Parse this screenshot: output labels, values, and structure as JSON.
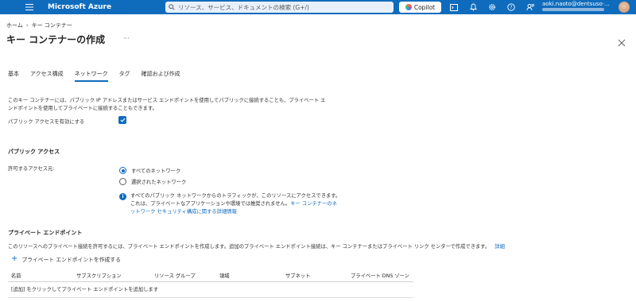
{
  "header": {
    "brand": "Microsoft Azure",
    "search_placeholder": "リソース、サービス、ドキュメントの検索 (G+/)",
    "copilot_label": "Copilot",
    "account_name": "aoki.naoto@dentsuso·..."
  },
  "breadcrumb": {
    "home": "ホーム",
    "current": "キー コンテナー"
  },
  "page": {
    "title": "キー コンテナーの作成",
    "more": "···"
  },
  "tabs": [
    {
      "label": "基本"
    },
    {
      "label": "アクセス構成"
    },
    {
      "label": "ネットワーク"
    },
    {
      "label": "タグ"
    },
    {
      "label": "確認および作成"
    }
  ],
  "network": {
    "description": "このキー コンテナーには、パブリック IP アドレスまたはサービス エンドポイントを使用してパブリックに接続することも、プライベート エンドポイントを使用してプライベートに接続することもできます。",
    "public_access_label": "パブリック アクセスを有効にする",
    "public_access_enabled": true,
    "public_access_heading": "パブリック アクセス",
    "allow_access_label": "許可するアクセス元:",
    "options": [
      {
        "label": "すべてのネットワーク",
        "selected": true
      },
      {
        "label": "選択されたネットワーク",
        "selected": false
      }
    ],
    "info_text": "すべてのパブリック ネットワークからのトラフィックが、このリソースにアクセスできます。これは、プライベートなアプリケーションや環境では推奨されません。",
    "info_link": "キー コンテナーのネットワーク セキュリティ構成に関する詳細情報"
  },
  "private_endpoint": {
    "heading": "プライベート エンドポイント",
    "description": "このリソースへのプライベート接続を許可するには、プライベート エンドポイントを作成します。追加のプライベート エンドポイント接続は、キー コンテナーまたはプライベート リンク センターで作成できます。",
    "details_link": "詳細",
    "create_label": "プライベート エンドポイントを作成する",
    "columns": [
      "名前",
      "サブスクリプション",
      "リソース グループ",
      "領域",
      "サブネット",
      "プライベート DNS ゾーン"
    ],
    "empty_text": "[追加] をクリックしてプライベート エンドポイントを追加します"
  },
  "colors": {
    "accent": "#0f6cbd",
    "topbar": "#0f6cbd"
  }
}
